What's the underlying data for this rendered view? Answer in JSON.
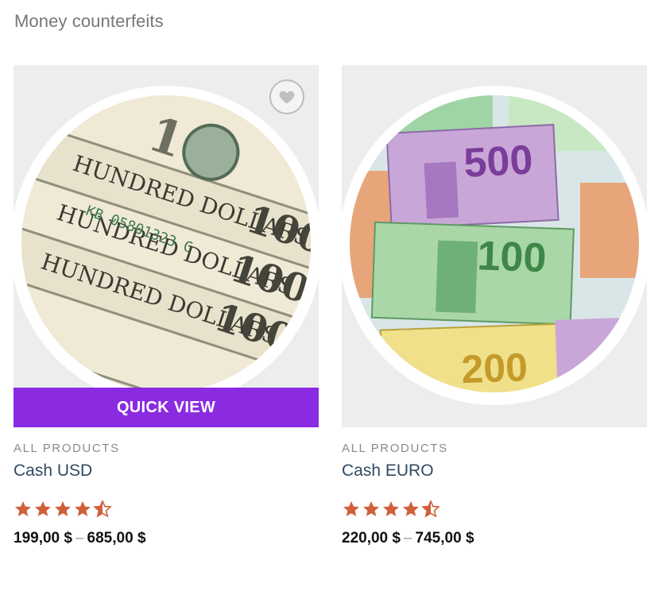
{
  "page": {
    "heading": "Money counterfeits"
  },
  "products": [
    {
      "category": "ALL PRODUCTS",
      "title": "Cash USD",
      "rating": 4.5,
      "price_min": "199,00 $",
      "price_sep": "–",
      "price_max": "685,00 $",
      "quick_view_label": "QUICK VIEW",
      "wishlist_icon": "heart-icon"
    },
    {
      "category": "ALL PRODUCTS",
      "title": "Cash EURO",
      "rating": 4.5,
      "price_min": "220,00 $",
      "price_sep": "–",
      "price_max": "745,00 $"
    }
  ],
  "colors": {
    "accent": "#8a2be2",
    "star": "#d0603a",
    "title": "#2f4a63"
  }
}
